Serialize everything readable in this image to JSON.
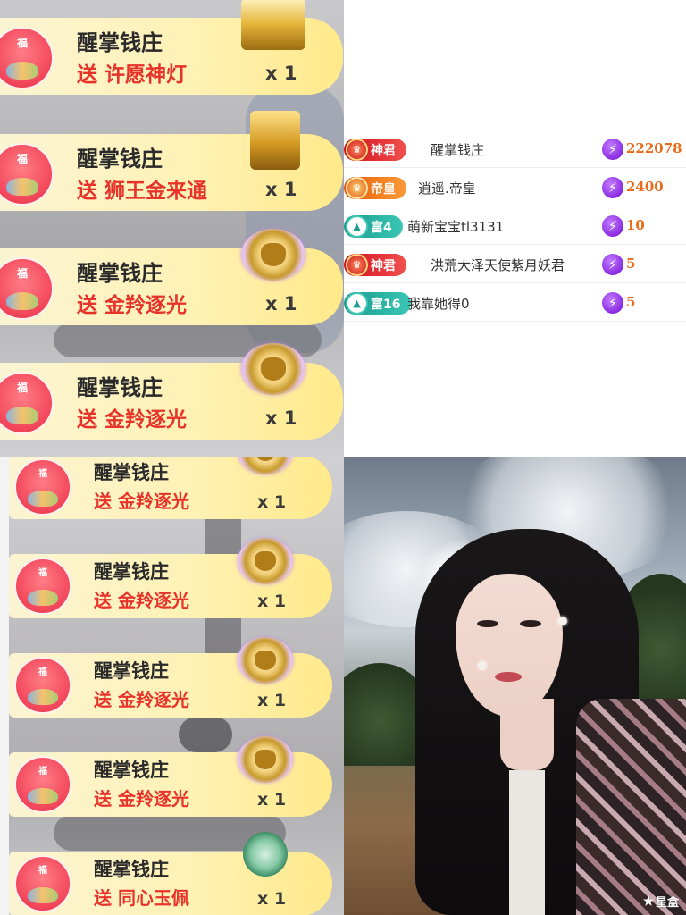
{
  "top_left_feed": [
    {
      "sender": "醒掌钱庄",
      "gift_text": "送 许愿神灯",
      "count": "x 1",
      "icon": "magic-lamp-icon",
      "avatar_char": "福"
    },
    {
      "sender": "醒掌钱庄",
      "gift_text": "送 狮王金来通",
      "count": "x 1",
      "icon": "golden-lion-icon",
      "avatar_char": "福"
    },
    {
      "sender": "醒掌钱庄",
      "gift_text": "送 金羚逐光",
      "count": "x 1",
      "icon": "antelope-medal-icon",
      "avatar_char": "福"
    },
    {
      "sender": "醒掌钱庄",
      "gift_text": "送 金羚逐光",
      "count": "x 1",
      "icon": "antelope-medal-icon",
      "avatar_char": "福"
    }
  ],
  "bottom_left_feed": [
    {
      "sender": "醒掌钱庄",
      "gift_text": "送 金羚逐光",
      "count": "x 1",
      "icon": "antelope-medal-icon",
      "avatar_char": "福"
    },
    {
      "sender": "醒掌钱庄",
      "gift_text": "送 金羚逐光",
      "count": "x 1",
      "icon": "antelope-medal-icon",
      "avatar_char": "福"
    },
    {
      "sender": "醒掌钱庄",
      "gift_text": "送 金羚逐光",
      "count": "x 1",
      "icon": "antelope-medal-icon",
      "avatar_char": "福"
    },
    {
      "sender": "醒掌钱庄",
      "gift_text": "送 金羚逐光",
      "count": "x 1",
      "icon": "antelope-medal-icon",
      "avatar_char": "福"
    },
    {
      "sender": "醒掌钱庄",
      "gift_text": "送 同心玉佩",
      "count": "x 1",
      "icon": "jade-pendant-icon",
      "avatar_char": "福"
    }
  ],
  "ranking": [
    {
      "badge": "神君",
      "badge_color": "#d8242a",
      "name": "醒掌钱庄",
      "score": "222078"
    },
    {
      "badge": "帝皇",
      "badge_color": "#f07a1c",
      "name": "逍遥.帝皇",
      "score": "2400"
    },
    {
      "badge": "富4",
      "badge_color": "#2bb5a5",
      "name": "萌新宝宝tl3131",
      "score": "10"
    },
    {
      "badge": "神君",
      "badge_color": "#d8242a",
      "name": "洪荒大泽天使紫月妖君",
      "score": "5"
    },
    {
      "badge": "富16",
      "badge_color": "#2bb5a5",
      "name": "我靠她得0",
      "score": "5"
    }
  ],
  "colors": {
    "gift_text": "#e8332a",
    "score": "#e86c1a",
    "banner_yellow": "#fff2b6",
    "bolt_purple": "#8a2be2"
  },
  "watermark": "星盒"
}
